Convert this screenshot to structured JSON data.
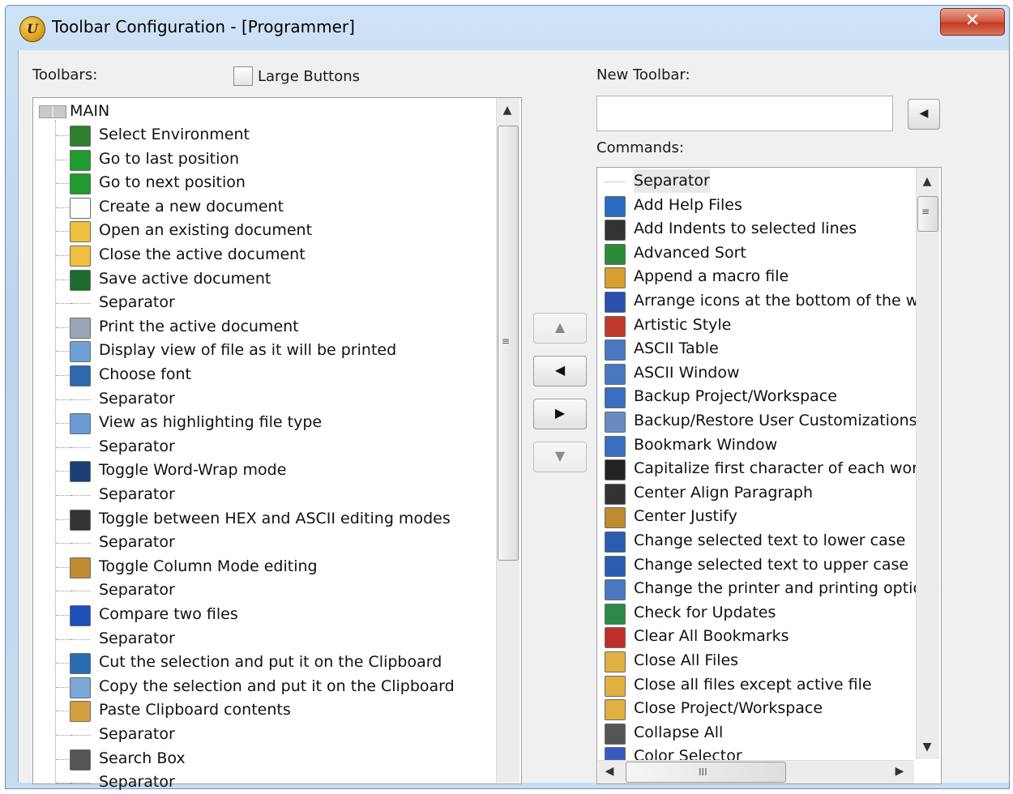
{
  "window": {
    "title": "Toolbar Configuration - [Programmer]",
    "app_icon": "ultraedit-logo-icon",
    "app_icon_letter": "U",
    "close_glyph": "✕"
  },
  "toolbars": {
    "label": "Toolbars:",
    "large_buttons_label": "Large Buttons",
    "large_buttons_checked": false,
    "root": "MAIN",
    "items": [
      {
        "label": "Select Environment",
        "icon": "environment-icon",
        "color": "#2f7d2f"
      },
      {
        "label": "Go to last position",
        "icon": "arrow-left-green-icon",
        "color": "#1f9a2f"
      },
      {
        "label": "Go to next position",
        "icon": "arrow-right-green-icon",
        "color": "#1f9a2f"
      },
      {
        "label": "Create a new document",
        "icon": "new-document-icon",
        "color": "#ffffff"
      },
      {
        "label": "Open an existing document",
        "icon": "open-folder-icon",
        "color": "#f0c040"
      },
      {
        "label": "Close the active document",
        "icon": "close-folder-icon",
        "color": "#f0c040"
      },
      {
        "label": "Save active document",
        "icon": "save-disk-icon",
        "color": "#1e6a2e"
      },
      {
        "label": "Separator",
        "icon": "separator",
        "color": ""
      },
      {
        "label": "Print the active document",
        "icon": "printer-icon",
        "color": "#9aa7b8"
      },
      {
        "label": "Display view of file as it will be printed",
        "icon": "print-preview-icon",
        "color": "#6fa0d8"
      },
      {
        "label": "Choose font",
        "icon": "font-icon",
        "color": "#2d6ab0"
      },
      {
        "label": "Separator",
        "icon": "separator",
        "color": ""
      },
      {
        "label": "View as highlighting file type",
        "icon": "highlight-document-icon",
        "color": "#6d9bd6"
      },
      {
        "label": "Separator",
        "icon": "separator",
        "color": ""
      },
      {
        "label": "Toggle Word-Wrap mode",
        "icon": "word-wrap-icon",
        "color": "#1b3e78"
      },
      {
        "label": "Separator",
        "icon": "separator",
        "color": ""
      },
      {
        "label": "Toggle between HEX and ASCII editing modes",
        "icon": "hex-icon",
        "color": "#333333"
      },
      {
        "label": "Separator",
        "icon": "separator",
        "color": ""
      },
      {
        "label": "Toggle Column Mode editing",
        "icon": "column-mode-icon",
        "color": "#c08a30"
      },
      {
        "label": "Separator",
        "icon": "separator",
        "color": ""
      },
      {
        "label": "Compare two files",
        "icon": "compare-icon",
        "color": "#1d4fb8"
      },
      {
        "label": "Separator",
        "icon": "separator",
        "color": ""
      },
      {
        "label": "Cut the selection and put it on the Clipboard",
        "icon": "scissors-icon",
        "color": "#2b6cb5"
      },
      {
        "label": "Copy the selection and put it on the Clipboard",
        "icon": "copy-icon",
        "color": "#7aa7d8"
      },
      {
        "label": "Paste Clipboard contents",
        "icon": "paste-icon",
        "color": "#d2a040"
      },
      {
        "label": "Separator",
        "icon": "separator",
        "color": ""
      },
      {
        "label": "Search Box",
        "icon": "search-box-icon",
        "color": "#555555"
      },
      {
        "label": "Separator",
        "icon": "separator",
        "color": ""
      }
    ]
  },
  "new_toolbar": {
    "label": "New Toolbar:",
    "value": "",
    "add_glyph": "◀"
  },
  "commands": {
    "label": "Commands:",
    "items": [
      {
        "label": "Separator",
        "icon": "separator",
        "color": ""
      },
      {
        "label": "Add Help Files",
        "icon": "help-files-icon",
        "color": "#2a6cc0"
      },
      {
        "label": "Add Indents to selected lines",
        "icon": "indent-icon",
        "color": "#333333"
      },
      {
        "label": "Advanced Sort",
        "icon": "sort-az-icon",
        "color": "#2a8a3a"
      },
      {
        "label": "Append a macro file",
        "icon": "macro-icon",
        "color": "#d8a030"
      },
      {
        "label": "Arrange icons at the bottom of the win",
        "icon": "arrange-icons-icon",
        "color": "#2a4fb0"
      },
      {
        "label": "Artistic Style",
        "icon": "artistic-style-icon",
        "color": "#c03a2a"
      },
      {
        "label": "ASCII Table",
        "icon": "ascii-table-icon",
        "color": "#4a78c0"
      },
      {
        "label": "ASCII Window",
        "icon": "ascii-window-icon",
        "color": "#4a78c0"
      },
      {
        "label": "Backup Project/Workspace",
        "icon": "backup-icon",
        "color": "#3a6ec0"
      },
      {
        "label": "Backup/Restore User Customizations",
        "icon": "restore-icon",
        "color": "#6a8ac0"
      },
      {
        "label": "Bookmark Window",
        "icon": "bookmark-window-icon",
        "color": "#3a6ec0"
      },
      {
        "label": "Capitalize first character of each word",
        "icon": "capitalize-icon",
        "color": "#222222"
      },
      {
        "label": "Center Align Paragraph",
        "icon": "center-align-icon",
        "color": "#333333"
      },
      {
        "label": "Center Justify",
        "icon": "center-justify-icon",
        "color": "#c08a30"
      },
      {
        "label": "Change selected text to lower case",
        "icon": "lowercase-icon",
        "color": "#2a5cb0"
      },
      {
        "label": "Change selected text to upper case",
        "icon": "uppercase-icon",
        "color": "#2a5cb0"
      },
      {
        "label": "Change the printer and printing options",
        "icon": "printer-options-icon",
        "color": "#4a78c0"
      },
      {
        "label": "Check for Updates",
        "icon": "globe-icon",
        "color": "#2a8a4a"
      },
      {
        "label": "Clear All Bookmarks",
        "icon": "clear-bookmarks-icon",
        "color": "#c0302a"
      },
      {
        "label": "Close All Files",
        "icon": "close-all-files-icon",
        "color": "#e0b040"
      },
      {
        "label": "Close all files except active file",
        "icon": "close-except-icon",
        "color": "#e0b040"
      },
      {
        "label": "Close Project/Workspace",
        "icon": "close-project-icon",
        "color": "#e0b040"
      },
      {
        "label": "Collapse All",
        "icon": "collapse-all-icon",
        "color": "#555555"
      },
      {
        "label": "Color Selector",
        "icon": "color-selector-icon",
        "color": "#3a5ac0"
      }
    ]
  },
  "move_buttons": {
    "up": "▲",
    "left": "◀",
    "right": "▶",
    "down": "▼"
  },
  "scrollbar_glyphs": {
    "up": "▲",
    "down": "▼",
    "left": "◀",
    "right": "▶",
    "grip_v": "≡",
    "grip_h": "III"
  }
}
